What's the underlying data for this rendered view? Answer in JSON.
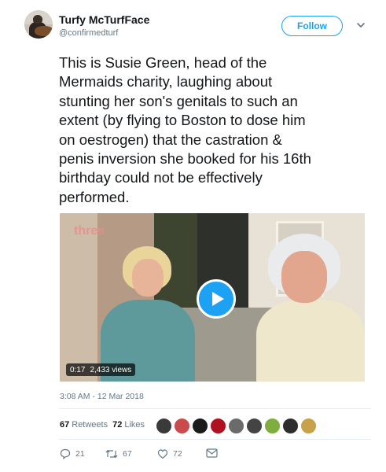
{
  "user": {
    "name": "Turfy McTurfFace",
    "handle": "@confirmedturf"
  },
  "follow_label": "Follow",
  "tweet": {
    "lines": [
      "This is Susie Green, head of the",
      "Mermaids charity, laughing about",
      "stunting her son's genitals to such an",
      "extent (by flying to Boston to dose him",
      "on oestrogen) that the castration &",
      "penis inversion she booked for his 16th",
      "birthday could not be effectively",
      "performed."
    ]
  },
  "video": {
    "duration": "0:17",
    "views": "2,433 views",
    "watermark": "three"
  },
  "timestamp": "3:08 AM - 12 Mar 2018",
  "stats": {
    "retweets_count": "67",
    "retweets_label": "Retweets",
    "likes_count": "72",
    "likes_label": "Likes",
    "liker_avatar_colors": [
      "#3a3a3a",
      "#c94b4b",
      "#1b1b1b",
      "#b01020",
      "#6b6b6b",
      "#444444",
      "#7fae3f",
      "#2e2e2e",
      "#c8a24a"
    ]
  },
  "actions": {
    "reply_count": "21",
    "retweet_count": "67",
    "like_count": "72"
  },
  "colors": {
    "accent": "#1da1f2",
    "secondary_text": "#657786",
    "primary_text": "#14171a"
  }
}
